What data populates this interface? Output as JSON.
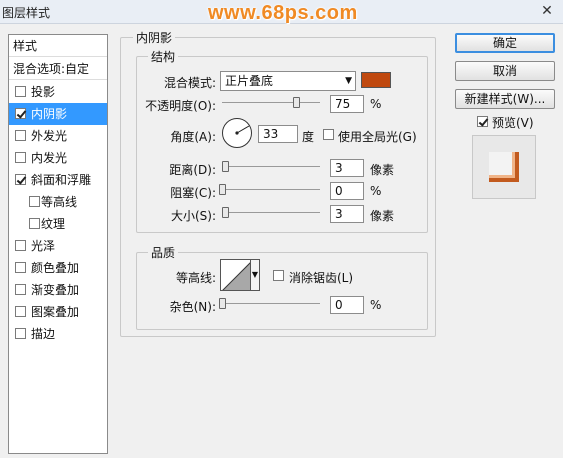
{
  "window": {
    "title": "图层样式",
    "watermark": "www.68ps.com",
    "close_glyph": "✕"
  },
  "styles_panel": {
    "header": "样式",
    "blend_options": "混合选项:自定",
    "items": [
      {
        "label": "投影",
        "checked": false,
        "selected": false,
        "sub": false
      },
      {
        "label": "内阴影",
        "checked": true,
        "selected": true,
        "sub": false
      },
      {
        "label": "外发光",
        "checked": false,
        "selected": false,
        "sub": false
      },
      {
        "label": "内发光",
        "checked": false,
        "selected": false,
        "sub": false
      },
      {
        "label": "斜面和浮雕",
        "checked": true,
        "selected": false,
        "sub": false
      },
      {
        "label": "等高线",
        "checked": false,
        "selected": false,
        "sub": true
      },
      {
        "label": "纹理",
        "checked": false,
        "selected": false,
        "sub": true
      },
      {
        "label": "光泽",
        "checked": false,
        "selected": false,
        "sub": false
      },
      {
        "label": "颜色叠加",
        "checked": false,
        "selected": false,
        "sub": false
      },
      {
        "label": "渐变叠加",
        "checked": false,
        "selected": false,
        "sub": false
      },
      {
        "label": "图案叠加",
        "checked": false,
        "selected": false,
        "sub": false
      },
      {
        "label": "描边",
        "checked": false,
        "selected": false,
        "sub": false
      }
    ]
  },
  "inner_shadow": {
    "section_title": "内阴影",
    "structure": {
      "title": "结构",
      "blend_mode_label": "混合模式:",
      "blend_mode_value": "正片叠底",
      "color": "#c0490f",
      "opacity_label": "不透明度(O):",
      "opacity_value": "75",
      "opacity_unit": "%",
      "opacity_level": 0.75,
      "angle_label": "角度(A):",
      "angle_value": "33",
      "angle_unit": "度",
      "global_light_label": "使用全局光(G)",
      "global_light_checked": false,
      "distance_label": "距离(D):",
      "distance_value": "3",
      "distance_unit": "像素",
      "choke_label": "阻塞(C):",
      "choke_value": "0",
      "choke_unit": "%",
      "size_label": "大小(S):",
      "size_value": "3",
      "size_unit": "像素"
    },
    "quality": {
      "title": "品质",
      "contour_label": "等高线:",
      "anti_alias_label": "消除锯齿(L)",
      "anti_alias_checked": false,
      "noise_label": "杂色(N):",
      "noise_value": "0",
      "noise_unit": "%"
    }
  },
  "buttons": {
    "ok": "确定",
    "cancel": "取消",
    "new_style": "新建样式(W)...",
    "preview_label": "预览(V)",
    "preview_checked": true
  }
}
